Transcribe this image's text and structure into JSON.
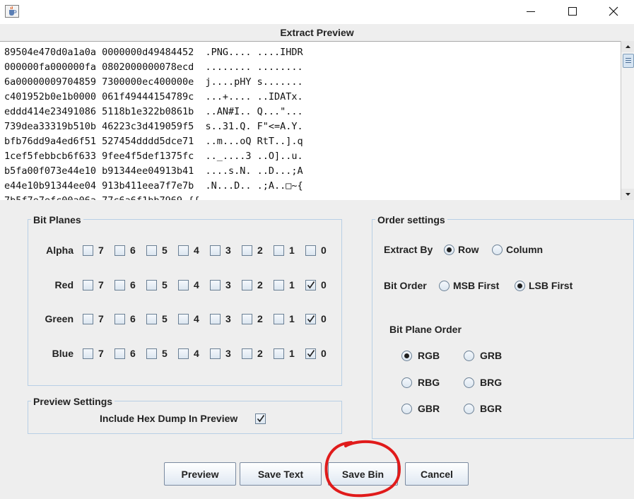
{
  "window": {
    "controls": {
      "minimize": "minimize-icon",
      "maximize": "maximize-icon",
      "close": "close-icon"
    },
    "app_icon": "java-cup-icon"
  },
  "preview": {
    "title": "Extract Preview",
    "lines": [
      "89504e470d0a1a0a 0000000d49484452  .PNG.... ....IHDR",
      "000000fa000000fa 0802000000078ecd  ........ ........",
      "6a00000009704859 7300000ec400000e  j....pHY s.......",
      "c401952b0e1b0000 061f49444154789c  ...+.... ..IDATx.",
      "eddd414e23491086 5118b1e322b0861b  ..AN#I.. Q...\"...",
      "739dea33319b510b 46223c3d419059f5  s..31.Q. F\"<=A.Y.",
      "bfb76dd9a4ed6f51 527454dddd5dce71  ..m...oQ RtT..].q",
      "1cef5febbcb6f633 9fee4f5def1375fc  .._....3 ..O]..u.",
      "b5fa00f073e44e10 b91344ee04913b41  ....s.N. ..D...;A",
      "e44e10b91344ee04 913b411eea7f7e7b  .N...D.. .;A..□~{",
      "7b5f7e7efc00a06a 77c6a6f1bb7969 {{_"
    ]
  },
  "bit_planes": {
    "title": "Bit Planes",
    "bits": [
      "7",
      "6",
      "5",
      "4",
      "3",
      "2",
      "1",
      "0"
    ],
    "rows": [
      {
        "label": "Alpha",
        "checked": [
          false,
          false,
          false,
          false,
          false,
          false,
          false,
          false
        ]
      },
      {
        "label": "Red",
        "checked": [
          false,
          false,
          false,
          false,
          false,
          false,
          false,
          true
        ]
      },
      {
        "label": "Green",
        "checked": [
          false,
          false,
          false,
          false,
          false,
          false,
          false,
          true
        ]
      },
      {
        "label": "Blue",
        "checked": [
          false,
          false,
          false,
          false,
          false,
          false,
          false,
          true
        ]
      }
    ]
  },
  "order": {
    "title": "Order settings",
    "extract_by": {
      "label": "Extract By",
      "options": [
        "Row",
        "Column"
      ],
      "selected": "Row"
    },
    "bit_order": {
      "label": "Bit Order",
      "options": [
        "MSB First",
        "LSB First"
      ],
      "selected": "LSB First"
    },
    "plane_order": {
      "label": "Bit Plane Order",
      "options": [
        "RGB",
        "GRB",
        "RBG",
        "BRG",
        "GBR",
        "BGR"
      ],
      "selected": "RGB"
    }
  },
  "preview_settings": {
    "title": "Preview Settings",
    "include_hex_label": "Include Hex Dump In Preview",
    "include_hex_checked": true
  },
  "buttons": {
    "preview": "Preview",
    "save_text": "Save Text",
    "save_bin": "Save Bin",
    "cancel": "Cancel"
  },
  "annotation": {
    "color": "#e01b1b",
    "target": "Save Bin"
  },
  "colors": {
    "group_border": "#b8cfe5",
    "panel_bg": "#eeeeee"
  }
}
